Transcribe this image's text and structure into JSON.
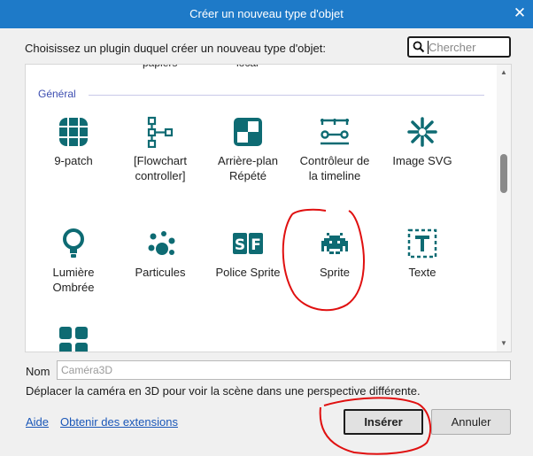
{
  "window": {
    "title": "Créer un nouveau type d'objet",
    "close_glyph": "✕"
  },
  "prompt": "Choisissez un plugin duquel créer un nouveau type d'objet:",
  "search": {
    "placeholder": "Chercher",
    "value": ""
  },
  "list": {
    "cut_labels": [
      "papiers",
      "local"
    ],
    "group": "Général",
    "items": [
      {
        "label": "9-patch",
        "icon": "nine-patch-icon"
      },
      {
        "label": "[Flowchart controller]",
        "icon": "flowchart-icon"
      },
      {
        "label": "Arrière-plan Répété",
        "icon": "tiled-background-icon"
      },
      {
        "label": "Contrôleur de la timeline",
        "icon": "timeline-controller-icon"
      },
      {
        "label": "Image SVG",
        "icon": "svg-image-icon"
      },
      {
        "label": "Lumière Ombrée",
        "icon": "light-bulb-icon"
      },
      {
        "label": "Particules",
        "icon": "particles-icon"
      },
      {
        "label": "Police Sprite",
        "icon": "sprite-font-icon"
      },
      {
        "label": "Sprite",
        "icon": "space-invader-icon"
      },
      {
        "label": "Texte",
        "icon": "text-box-icon"
      },
      {
        "label": "",
        "icon": "grid-apps-icon"
      }
    ]
  },
  "name_field": {
    "label": "Nom",
    "placeholder": "Caméra3D",
    "value": ""
  },
  "description": "Déplacer la caméra en 3D pour voir la scène dans une perspective différente.",
  "footer": {
    "help_link": "Aide",
    "extensions_link": "Obtenir des extensions",
    "insert_button": "Insérer",
    "cancel_button": "Annuler"
  },
  "colors": {
    "titlebar": "#1e7ac8",
    "icon": "#0e6b73",
    "link": "#1a57b8",
    "annotation": "#e01010"
  }
}
